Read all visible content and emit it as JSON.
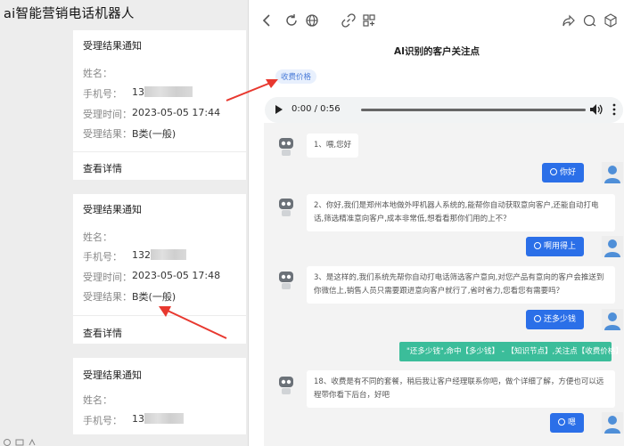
{
  "app": {
    "title": "ai智能营销电话机器人"
  },
  "cards": [
    {
      "title": "受理结果通知",
      "name_label": "姓名：",
      "name_value": "",
      "phone_label": "手机号：",
      "phone_prefix": "13",
      "time_label": "受理时间：",
      "time_value": "2023-05-05 17:44",
      "result_label": "受理结果：",
      "result_value": "B类(一般)",
      "detail_label": "查看详情"
    },
    {
      "title": "受理结果通知",
      "name_label": "姓名：",
      "name_value": "",
      "phone_label": "手机号：",
      "phone_prefix": "132",
      "time_label": "受理时间：",
      "time_value": "2023-05-05 17:48",
      "result_label": "受理结果：",
      "result_value": "B类(一般)",
      "detail_label": "查看详情"
    },
    {
      "title": "受理结果通知",
      "name_label": "姓名：",
      "name_value": "",
      "phone_label": "手机号：",
      "phone_prefix": "13"
    }
  ],
  "panel": {
    "title": "AI识别的客户关注点",
    "tag": "收费价格"
  },
  "audio": {
    "time": "0:00 / 0:56",
    "progress": 0
  },
  "chat": {
    "bot": [
      "1、喂,您好",
      "2、你好,我们是郑州本地做外呼机器人系统的,能帮你自动获取意向客户,还能自动打电话,筛选精准意向客户,成本非常低,想看看那你们用的上不？",
      "3、是这样的,我们系统先帮你自动打电话筛选客户意向,对您产品有意向的客户会推送到你微信上,销售人员只需要跟进意向客户就行了,省时省力,您看您有需要吗？",
      "18、收费是有不同的套餐，稍后我让客户经理联系你吧，做个详细了解，方便也可以远程带你看下后台，好吧"
    ],
    "user": [
      "你好",
      "啊用得上",
      "还多少钱",
      "嗯"
    ],
    "keyword_line": "\"还多少钱\",命中【多少钱】 - 【知识节点】,关注点【收费价格】"
  },
  "colors": {
    "accent": "#2b6fe8",
    "keyword_bg": "#3bbd9a",
    "arrow": "#e8382f"
  }
}
